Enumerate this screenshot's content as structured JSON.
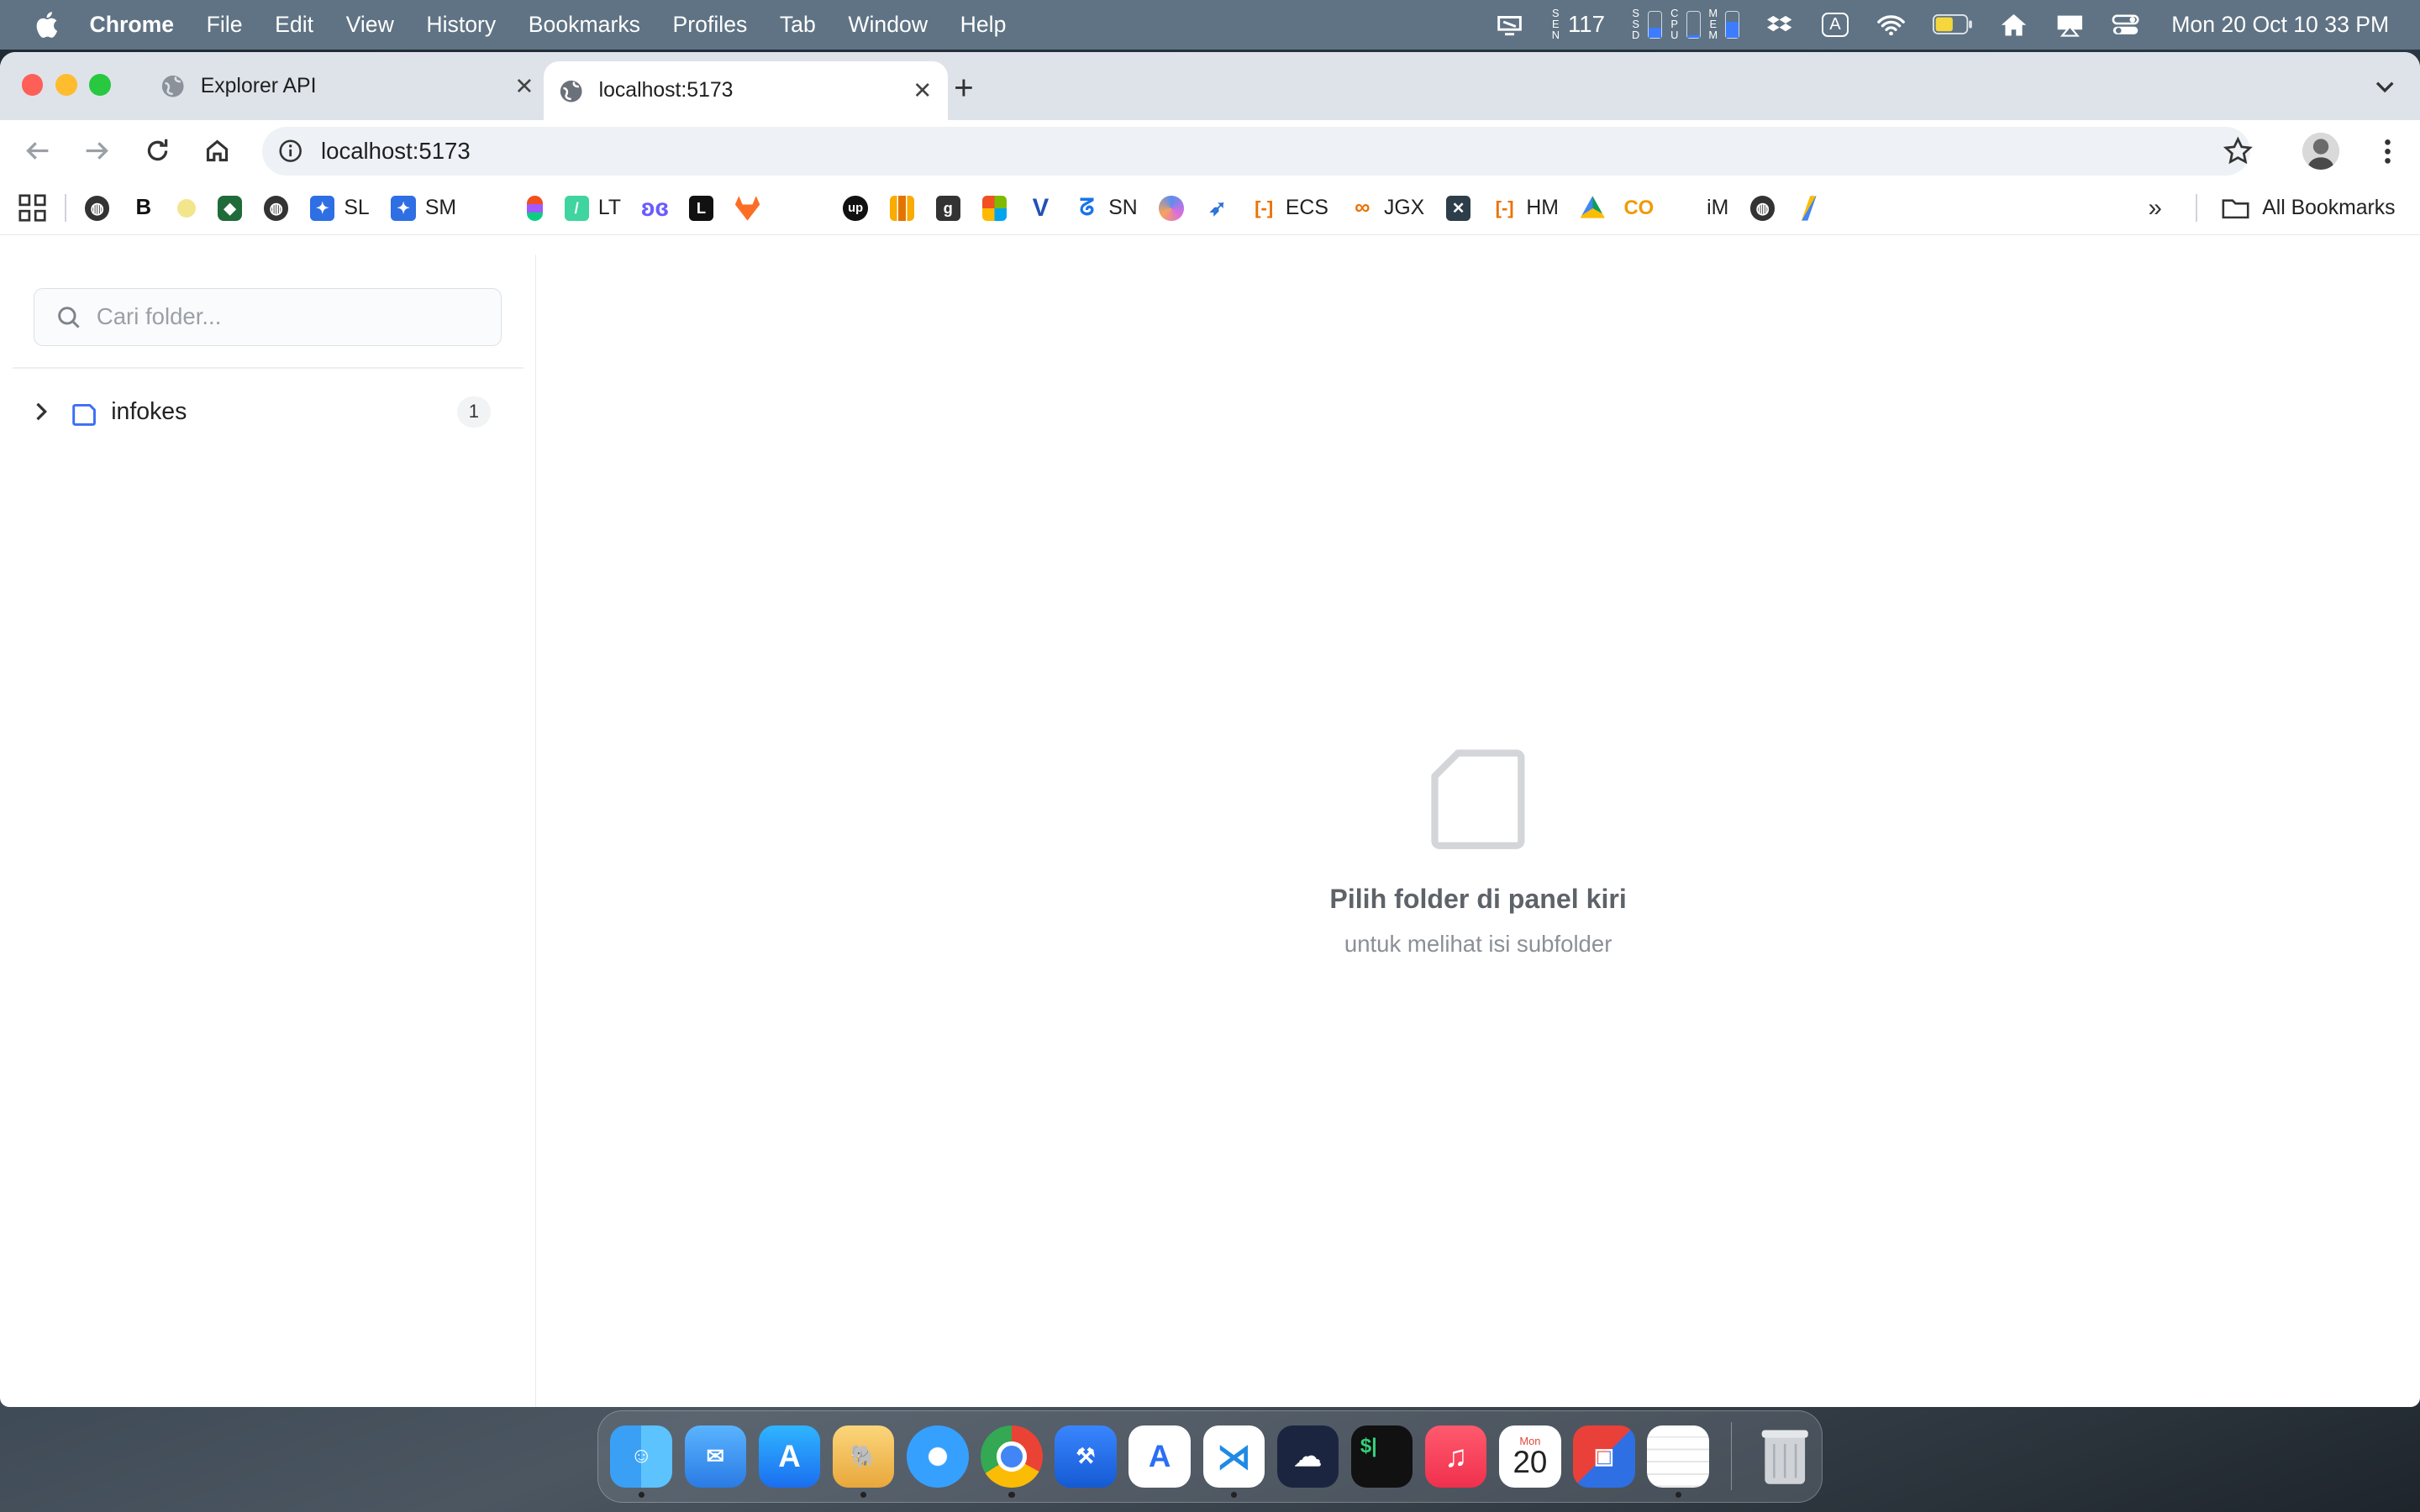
{
  "menubar": {
    "app_name": "Chrome",
    "menus": [
      "File",
      "Edit",
      "View",
      "History",
      "Bookmarks",
      "Profiles",
      "Tab",
      "Window",
      "Help"
    ],
    "status": {
      "sensor_label": "S\nE\nN",
      "sensor_value": "117",
      "ssd_label": "S\nS\nD",
      "cpu_label": "C\nP\nU",
      "mem_label": "M\nE\nM",
      "input_source": "A",
      "clock": "Mon 20 Oct  10 33 PM"
    }
  },
  "tabs": [
    {
      "title": "Explorer API",
      "active": false
    },
    {
      "title": "localhost:5173",
      "active": true
    }
  ],
  "omnibox": {
    "url": "localhost:5173"
  },
  "bookmarks": {
    "items": [
      {
        "label": "",
        "icon": "globe-icon"
      },
      {
        "label": "",
        "icon": "b-icon"
      },
      {
        "label": "",
        "icon": "sun-icon"
      },
      {
        "label": "",
        "icon": "shield-icon"
      },
      {
        "label": "",
        "icon": "globe-icon"
      },
      {
        "label": "SL",
        "icon": "jira-icon"
      },
      {
        "label": "SM",
        "icon": "jira-icon"
      },
      {
        "label": "",
        "icon": "figma-icon"
      },
      {
        "label": "LT",
        "icon": "slash-icon"
      },
      {
        "label": "",
        "icon": "butterfly-icon"
      },
      {
        "label": "",
        "icon": "l-icon"
      },
      {
        "label": "",
        "icon": "gitlab-icon"
      },
      {
        "label": "",
        "icon": "upwork-icon"
      },
      {
        "label": "",
        "icon": "analytics-icon"
      },
      {
        "label": "",
        "icon": "g-icon"
      },
      {
        "label": "",
        "icon": "microsoft-icon"
      },
      {
        "label": "",
        "icon": "v-icon"
      },
      {
        "label": "SN",
        "icon": "sn-icon"
      },
      {
        "label": "",
        "icon": "copilot-icon"
      },
      {
        "label": "",
        "icon": "arrow-icon"
      },
      {
        "label": "ECS",
        "icon": "bracket-icon"
      },
      {
        "label": "JGX",
        "icon": "link-icon"
      },
      {
        "label": "",
        "icon": "tool-icon"
      },
      {
        "label": "HM",
        "icon": "bracket-icon"
      },
      {
        "label": "",
        "icon": "drive-icon"
      },
      {
        "label": "",
        "icon": "co-icon"
      },
      {
        "label": "iM",
        "icon": "apple-icon"
      },
      {
        "label": "",
        "icon": "globe-icon"
      },
      {
        "label": "",
        "icon": "ads-icon"
      }
    ],
    "all_bookmarks": "All Bookmarks"
  },
  "sidebar": {
    "search_placeholder": "Cari folder...",
    "tree": [
      {
        "label": "infokes",
        "count": "1"
      }
    ]
  },
  "main": {
    "empty_title": "Pilih folder di panel kiri",
    "empty_subtitle": "untuk melihat isi subfolder"
  },
  "dock": {
    "apps": [
      "finder",
      "mail",
      "app-store",
      "tableplus",
      "safari",
      "chrome",
      "xcode",
      "instruments",
      "vscode",
      "cloud",
      "terminal",
      "music",
      "calendar",
      "screens",
      "notes",
      "trash"
    ],
    "calendar_day": "20",
    "calendar_month": "Mon",
    "terminal_text": "$|"
  },
  "colors": {
    "accent_blue": "#3b6ff5",
    "menubar": "#5f7384",
    "tabstrip": "#dee3ea"
  }
}
